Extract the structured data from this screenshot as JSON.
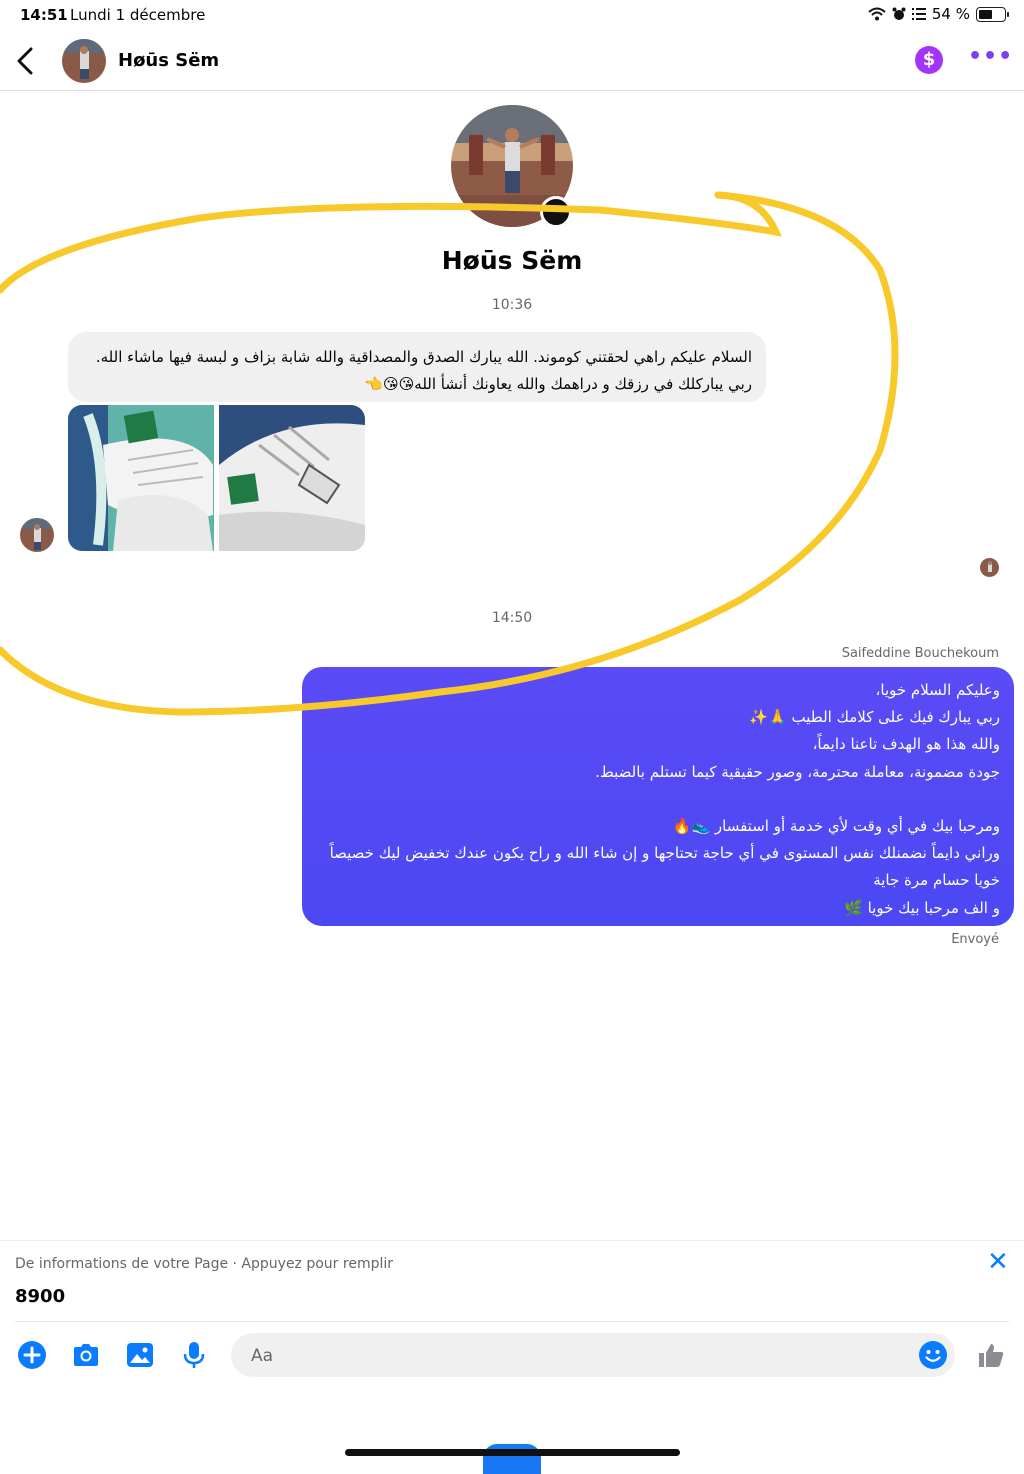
{
  "status_bar": {
    "time": "14:51",
    "date": "Lundi 1 décembre",
    "battery": "54 %",
    "battery_level": 0.54,
    "icons": [
      "wifi-icon",
      "alarm-icon",
      "list-icon",
      "battery-icon"
    ]
  },
  "header": {
    "contact_name": "Høūs Sëm",
    "back_icon": "chevron-left-icon",
    "pay_icon": "dollar-icon",
    "pay_symbol": "$",
    "more_symbol": "•••",
    "accent": "#7b3ff2"
  },
  "profile": {
    "name": "Høūs Sëm"
  },
  "conversation": {
    "time_1": "10:36",
    "received_message": "السلام عليكم راهي لحقتني كوموند. الله يبارك الصدق والمصداقية والله شابة بزاف و لبسة فيها ماشاء الله. ربي يباركلك في رزقك و دراهمك والله يعاونك أنشأ الله😘😘👈",
    "time_2": "14:50",
    "sender_name": "Saifeddine Bouchekoum",
    "sent_message": "وعليكم السلام خويا،\nربي يبارك فيك على كلامك الطيب 🙏✨\nوالله هذا هو الهدف تاعنا دايماً،\nجودة مضمونة، معاملة محترمة، وصور حقيقية كيما تستلم بالضبط.\n\nومرحبا بيك في أي وقت لأي خدمة أو استفسار 👟🔥\nوراني دايماً نضمنلك نفس المستوى في أي حاجة تحتاجها و إن شاء الله و راح يكون عندك تخفيض ليك خصيصاً خويا حسام مرة جاية\nو الف مرحبا بيك خويا 🌿",
    "sent_status": "Envoyé",
    "bubble_color": "#4b48f4"
  },
  "suggestion": {
    "label": "De informations de votre Page · Appuyez pour remplir",
    "value": "8900",
    "close_symbol": "✕"
  },
  "composer": {
    "placeholder": "Aa",
    "icons": [
      "plus-icon",
      "camera-icon",
      "image-icon",
      "microphone-icon",
      "emoji-icon",
      "like-icon"
    ],
    "accent": "#0a7cff"
  }
}
